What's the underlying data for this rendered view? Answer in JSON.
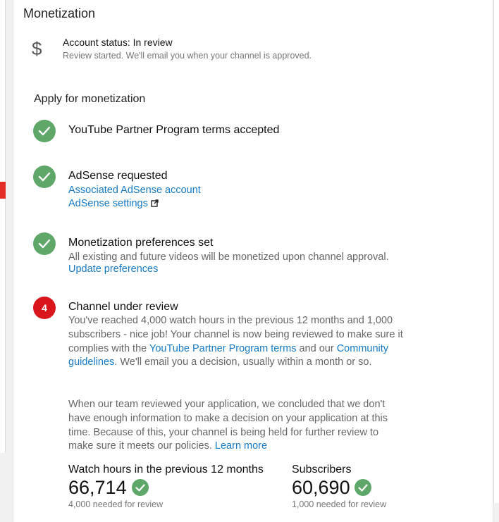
{
  "colors": {
    "accent_link": "#167ac6",
    "check_green": "#5fa768",
    "alert_red": "#d8161b"
  },
  "header": {
    "title": "Monetization"
  },
  "account": {
    "icon": "dollar-icon",
    "status": "Account status: In review",
    "detail": "Review started. We'll email you when your channel is approved."
  },
  "apply": {
    "heading": "Apply for monetization",
    "steps": [
      {
        "icon": "check-icon",
        "title": "YouTube Partner Program terms accepted"
      },
      {
        "icon": "check-icon",
        "title": "AdSense requested",
        "links": [
          "Associated AdSense account",
          "AdSense settings"
        ],
        "external_icon": "external-link-icon"
      },
      {
        "icon": "check-icon",
        "title": "Monetization preferences set",
        "description": "All existing and future videos will be monetized upon channel approval.",
        "link": "Update preferences"
      },
      {
        "badge": "4",
        "title": "Channel under review",
        "p1_part1": "You've reached 4,000 watch hours in the previous 12 months and 1,000 subscribers - nice job! Your channel is now being reviewed to make sure it complies with the ",
        "p1_link1": "YouTube Partner Program terms",
        "p1_part2": " and our ",
        "p1_link2": "Community guidelines",
        "p1_part3": ". We'll email you a decision, usually within a month or so.",
        "p2_text": "When our team reviewed your application, we concluded that we don't have enough information to make a decision on your application at this time. Because of this, your channel is being held for further review to make sure it meets our policies. ",
        "p2_link": "Learn more"
      }
    ]
  },
  "stats": [
    {
      "label": "Watch hours in the previous 12 months",
      "value": "66,714",
      "requirement": "4,000 needed for review",
      "icon": "check-icon"
    },
    {
      "label": "Subscribers",
      "value": "60,690",
      "requirement": "1,000 needed for review",
      "icon": "check-icon"
    }
  ]
}
